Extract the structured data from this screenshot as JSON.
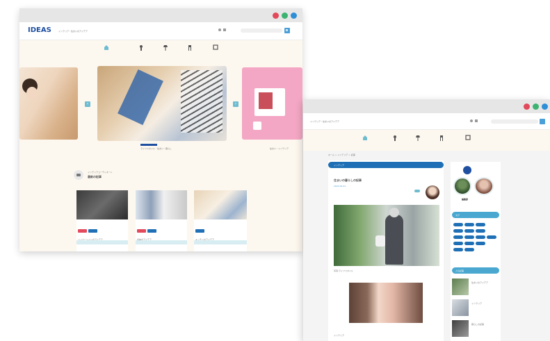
{
  "front": {
    "logo_text": "IDEAS",
    "site_subtitle": "インテリア・住まいのアイデア",
    "nav_items": [
      "",
      "",
      "",
      "",
      ""
    ],
    "slide_caption": "ライフスタイル・住まい・暮らし",
    "right_caption": "住まい・インテリア",
    "section_sub": "インテリアコーディネート",
    "section_title": "最新の記事",
    "cards": [
      {
        "title": "リノベーションのアイデア"
      },
      {
        "title": "収納のアイデア"
      },
      {
        "title": "キッチンのアイデア"
      }
    ]
  },
  "back": {
    "site_subtitle": "インテリア・住まいのアイデア",
    "breadcrumb": "ホーム > インテリア > 記事",
    "article_header": "インテリア",
    "article_title": "住まいの暮らしの記事",
    "article_meta": "2023.01.01",
    "image_caption": "写真:ライフスタイル",
    "after_caption": "インテリア",
    "profile_name": "編集部",
    "sidebar_tags_header": "タグ",
    "sidebar_popular_header": "人気記事",
    "popular": [
      "住まいのアイデア",
      "インテリア",
      "暮らしの記事"
    ]
  },
  "colors": {
    "close": "#e2495b",
    "minimize": "#3cb371",
    "maximize": "#2f8fd6",
    "accent": "#6fbcd0",
    "tag_red": "#e2495b",
    "tag_blue": "#1e6fb5"
  }
}
